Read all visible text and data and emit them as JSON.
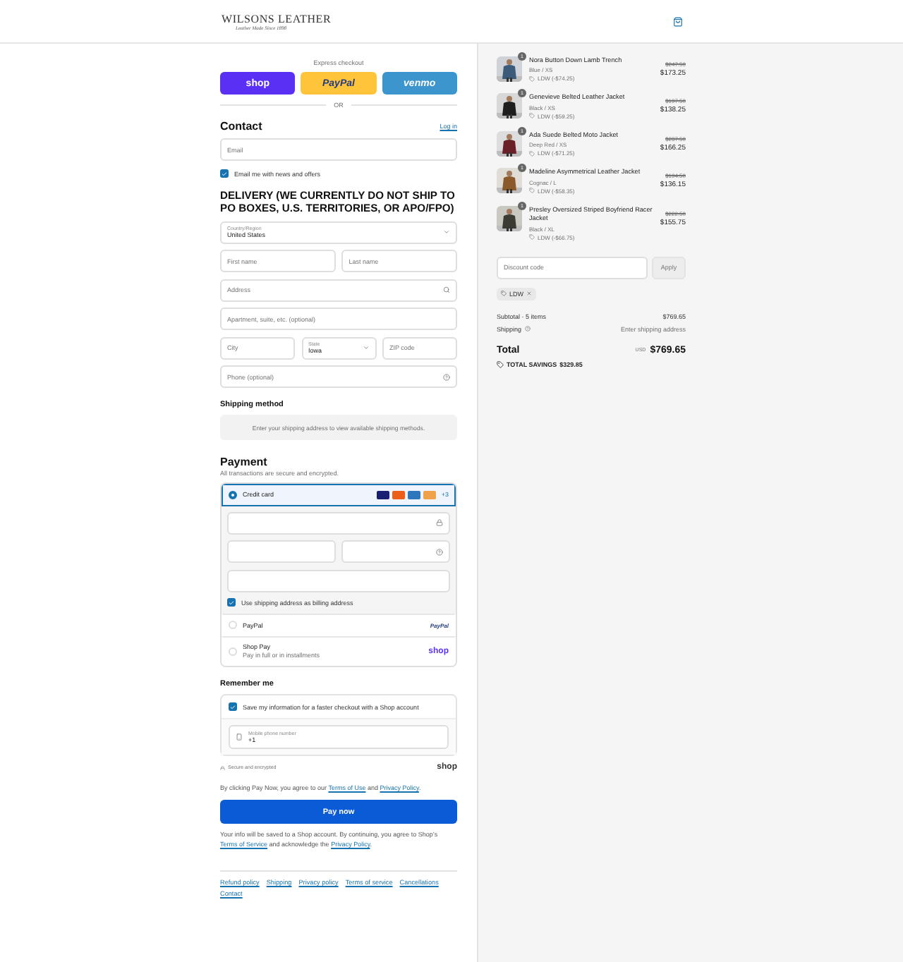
{
  "header": {
    "brand": "WILSONS LEATHER",
    "tagline": "Leather Made Since 1898"
  },
  "express": {
    "label": "Express checkout",
    "divider": "OR",
    "buttons": [
      {
        "kind": "shop",
        "label": "shop"
      },
      {
        "kind": "paypal",
        "label": "PayPal"
      },
      {
        "kind": "venmo",
        "label": "venmo"
      }
    ]
  },
  "contact": {
    "title": "Contact",
    "login": "Log in",
    "email_placeholder": "Email",
    "newsletter": {
      "label": "Email me with news and offers",
      "checked": true
    }
  },
  "delivery": {
    "title": "DELIVERY (WE CURRENTLY DO NOT SHIP TO PO BOXES, U.S. TERRITORIES, OR APO/FPO)",
    "rows": [
      [
        {
          "kind": "select",
          "label": "Country/Region",
          "value": "United States"
        }
      ],
      [
        {
          "kind": "text",
          "placeholder": "First name"
        },
        {
          "kind": "text",
          "placeholder": "Last name"
        }
      ],
      [
        {
          "kind": "search",
          "placeholder": "Address"
        }
      ],
      [
        {
          "kind": "text",
          "placeholder": "Apartment, suite, etc. (optional)"
        }
      ],
      [
        {
          "kind": "text",
          "placeholder": "City"
        },
        {
          "kind": "select",
          "label": "State",
          "value": "Iowa"
        },
        {
          "kind": "text",
          "placeholder": "ZIP code"
        }
      ],
      [
        {
          "kind": "help",
          "placeholder": "Phone (optional)"
        }
      ]
    ]
  },
  "shipping_method": {
    "title": "Shipping method",
    "message": "Enter your shipping address to view available shipping methods."
  },
  "payment": {
    "title": "Payment",
    "subtitle": "All transactions are secure and encrypted.",
    "more_cards": "+3",
    "card_fields": [
      {
        "kind": "lock"
      },
      {
        "kind": "half"
      },
      {
        "kind": "plain"
      }
    ],
    "billing": {
      "label": "Use shipping address as billing address",
      "checked": true
    },
    "methods": [
      {
        "kind": "card",
        "label": "Credit card",
        "selected": true
      },
      {
        "kind": "paypal",
        "label": "PayPal",
        "logo": "PayPal",
        "selected": false
      },
      {
        "kind": "shoppay",
        "label": "Shop Pay",
        "sublabel": "Pay in full or in installments",
        "logo": "shop",
        "selected": false
      }
    ]
  },
  "remember": {
    "title": "Remember me",
    "save": {
      "label": "Save my information for a faster checkout with a Shop account",
      "checked": true
    },
    "phone": {
      "label": "Mobile phone number",
      "value": "+1"
    },
    "secure": "Secure and encrypted",
    "brand": "shop"
  },
  "agreement": [
    {
      "kind": "text",
      "text": "By clicking Pay Now, you agree to our "
    },
    {
      "kind": "link",
      "text": "Terms of Use"
    },
    {
      "kind": "text",
      "text": " and "
    },
    {
      "kind": "link",
      "text": "Privacy Policy"
    },
    {
      "kind": "text",
      "text": "."
    }
  ],
  "pay_button": "Pay now",
  "shop_notice": [
    {
      "kind": "text",
      "text": "Your info will be saved to a Shop account. By continuing, you agree to Shop’s "
    },
    {
      "kind": "link",
      "text": "Terms of Service"
    },
    {
      "kind": "text",
      "text": " and acknowledge the "
    },
    {
      "kind": "link",
      "text": "Privacy Policy"
    },
    {
      "kind": "text",
      "text": "."
    }
  ],
  "footer_links": [
    "Refund policy",
    "Shipping",
    "Privacy policy",
    "Terms of service",
    "Cancellations",
    "Contact"
  ],
  "order": {
    "items": [
      {
        "name": "Nora Button Down Lamb Trench",
        "variant": "Blue / XS",
        "discount": "LDW (-$74.25)",
        "original": "$247.50",
        "price": "$173.25",
        "quantity": "1"
      },
      {
        "name": "Genevieve Belted Leather Jacket",
        "variant": "Black / XS",
        "discount": "LDW (-$59.25)",
        "original": "$197.50",
        "price": "$138.25",
        "quantity": "1"
      },
      {
        "name": "Ada Suede Belted Moto Jacket",
        "variant": "Deep Red / XS",
        "discount": "LDW (-$71.25)",
        "original": "$237.50",
        "price": "$166.25",
        "quantity": "1"
      },
      {
        "name": "Madeline Asymmetrical Leather Jacket",
        "variant": "Cognac / L",
        "discount": "LDW (-$58.35)",
        "original": "$194.50",
        "price": "$136.15",
        "quantity": "1"
      },
      {
        "name": "Presley Oversized Striped Boyfriend Racer Jacket",
        "variant": "Black / XL",
        "discount": "LDW (-$66.75)",
        "original": "$222.50",
        "price": "$155.75",
        "quantity": "1"
      }
    ],
    "discount_placeholder": "Discount code",
    "apply": "Apply",
    "tag": "LDW",
    "subtotal_label": "Subtotal · 5 items",
    "subtotal": "$769.65",
    "shipping_label": "Shipping",
    "shipping_value": "Enter shipping address",
    "total_label": "Total",
    "currency": "USD",
    "total": "$769.65",
    "savings_label": "TOTAL SAVINGS",
    "savings": "$329.85"
  }
}
